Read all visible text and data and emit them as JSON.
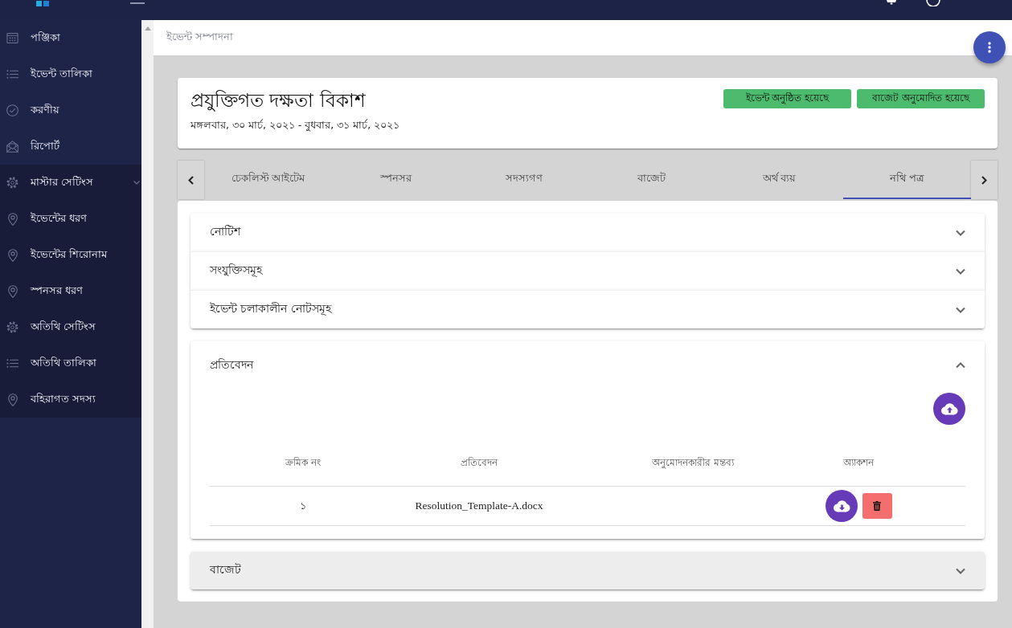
{
  "sidebar": {
    "items": [
      {
        "label": "পঞ্জিকা"
      },
      {
        "label": "ইভেন্ট তালিকা"
      },
      {
        "label": "করণীয়"
      },
      {
        "label": "রিপোর্ট"
      },
      {
        "label": "মাস্টার সেটিংস",
        "expanded": true,
        "children": [
          {
            "label": "ইভেন্টের ধরণ"
          },
          {
            "label": "ইভেন্টের শিরোনাম"
          },
          {
            "label": "স্পনসর ধরণ"
          },
          {
            "label": "অতিথি সেটিংস"
          },
          {
            "label": "অতিথি তালিকা"
          },
          {
            "label": "বহিরাগত সদস্য"
          }
        ]
      }
    ]
  },
  "breadcrumb": "ইভেন্ট সম্পাদনা",
  "event": {
    "title": "প্রযুক্তিগত দক্ষতা বিকাশ",
    "dates": "মঙ্গলবার, ৩০ মার্চ, ২০২১ - বুধবার, ৩১ মার্চ, ২০২১",
    "status_buttons": [
      "ইভেন্ট অনুষ্ঠিত হয়েছে",
      "বাজেট অনুমোদিত হয়েছে"
    ]
  },
  "tabs": [
    {
      "label": "চেকলিস্ট আইটেম",
      "selected": false
    },
    {
      "label": "স্পনসর",
      "selected": false
    },
    {
      "label": "সদস্যগণ",
      "selected": false
    },
    {
      "label": "বাজেট",
      "selected": false
    },
    {
      "label": "অর্থ ব্যয়",
      "selected": false
    },
    {
      "label": "নথি পত্র",
      "selected": true
    }
  ],
  "panels": [
    {
      "title": "নোটিশ",
      "expanded": false,
      "highlighted": false
    },
    {
      "title": "সংযুক্তিসমূহ",
      "expanded": false,
      "highlighted": false
    },
    {
      "title": "ইভেন্ট চলাকালীন নোটসমূহ",
      "expanded": false,
      "highlighted": false
    },
    {
      "title": "প্রতিবেদন",
      "expanded": true,
      "highlighted": false,
      "table": {
        "columns": [
          "ক্রমিক নং",
          "প্রতিবেদন",
          "অনুমোদনকারীর মন্তব্য",
          "অ্যাকশন"
        ],
        "rows": [
          {
            "serial": "১",
            "file": "Resolution_Template-A.docx"
          }
        ]
      }
    },
    {
      "title": "বাজেট",
      "expanded": false,
      "highlighted": true
    }
  ]
}
